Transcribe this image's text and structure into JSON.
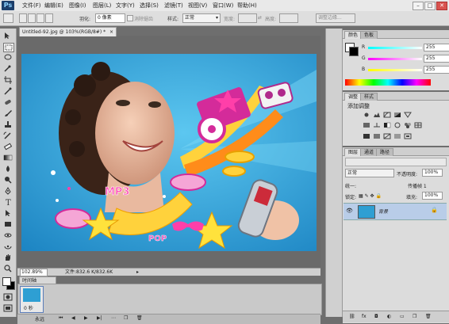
{
  "app": {
    "logo": "Ps"
  },
  "menu": [
    "文件(F)",
    "编辑(E)",
    "图像(I)",
    "图层(L)",
    "文字(Y)",
    "选择(S)",
    "滤镜(T)",
    "视图(V)",
    "窗口(W)",
    "帮助(H)"
  ],
  "window_buttons": [
    "–",
    "□",
    "✕"
  ],
  "options": {
    "feather_label": "羽化:",
    "feather_value": "0 像素",
    "antialias_label": "消除锯齿",
    "style_label": "样式:",
    "style_value": "正常",
    "width_label": "宽度:",
    "height_label": "高度:",
    "refine_edge": "调整边缘..."
  },
  "document": {
    "tab_title": "Untitled-92.jpg @ 103%(RGB/8#) *",
    "zoom": "102.89%",
    "file_info": "文件:832.6 K/832.6K",
    "canvas_text": [
      "MP3",
      "POP"
    ]
  },
  "timeline": {
    "tab": "时间轴",
    "frame_time": "0 秒",
    "loop": "永远"
  },
  "color_panel": {
    "tabs": [
      "颜色",
      "色板"
    ],
    "channels": [
      {
        "label": "R",
        "value": "255"
      },
      {
        "label": "G",
        "value": "255"
      },
      {
        "label": "B",
        "value": "255"
      }
    ]
  },
  "adjust_panel": {
    "tabs": [
      "调整",
      "样式"
    ],
    "title": "添加调整"
  },
  "layers_panel": {
    "tabs": [
      "图层",
      "通道",
      "路径"
    ],
    "blend_mode": "正常",
    "opacity_label": "不透明度:",
    "opacity_value": "100%",
    "lock_label": "锁定:",
    "fill_label": "填充:",
    "fill_value": "100%",
    "unify_label": "统一:",
    "propagate_label": "传播帧 1",
    "layer_name": "背景"
  },
  "colors": {
    "accent_layer": "#b9cde8",
    "canvas_bg": "#2e9fd3"
  }
}
